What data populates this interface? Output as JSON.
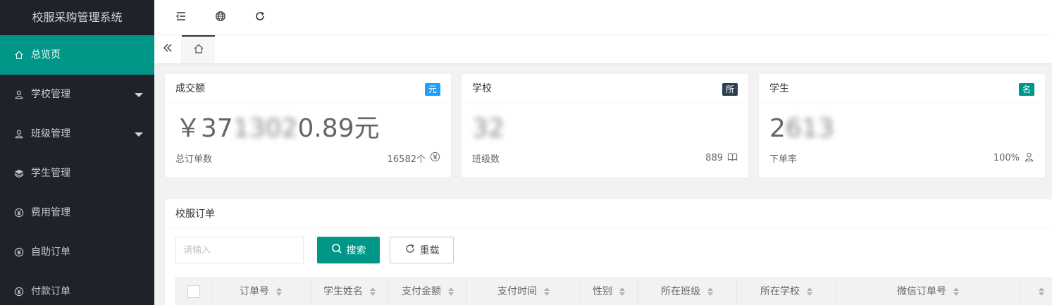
{
  "app": {
    "title": "校服采购管理系统"
  },
  "sidebar": {
    "items": [
      {
        "label": "总览页",
        "icon": "home-icon",
        "active": true
      },
      {
        "label": "学校管理",
        "icon": "user-icon",
        "has_children": true
      },
      {
        "label": "班级管理",
        "icon": "user-icon",
        "has_children": true
      },
      {
        "label": "学生管理",
        "icon": "layers-icon"
      },
      {
        "label": "费用管理",
        "icon": "yen-icon"
      },
      {
        "label": "自助订单",
        "icon": "yen-icon"
      },
      {
        "label": "付款订单",
        "icon": "yen-icon"
      }
    ]
  },
  "header": {
    "buttons": [
      "menu-fold-icon",
      "globe-icon",
      "refresh-icon"
    ]
  },
  "tabs": {
    "prev_icon": "double-left-icon",
    "home_icon": "home-icon"
  },
  "cards": [
    {
      "title": "成交额",
      "badge": "元",
      "badge_color": "#1e9fff",
      "value_prefix": "￥37",
      "value_blurred": "1302",
      "value_suffix": "0.89元",
      "foot_label": "总订单数",
      "foot_value": "16582个",
      "foot_icon": "yen-circle-icon"
    },
    {
      "title": "学校",
      "badge": "所",
      "badge_color": "#2f4056",
      "value_prefix": "",
      "value_blurred": "32",
      "value_suffix": "",
      "foot_label": "班级数",
      "foot_value": "889",
      "foot_icon": "book-icon"
    },
    {
      "title": "学生",
      "badge": "名",
      "badge_color": "#009688",
      "value_prefix": "2",
      "value_blurred": "613",
      "value_suffix": "",
      "foot_label": "下单率",
      "foot_value": "100%",
      "foot_icon": "user-icon"
    }
  ],
  "orders": {
    "title": "校服订单",
    "search_placeholder": "请输入",
    "search_label": "搜索",
    "reset_label": "重载",
    "columns": [
      "订单号",
      "学生姓名",
      "支付金额",
      "支付时间",
      "性别",
      "所在班级",
      "所在学校",
      "微信订单号"
    ]
  },
  "colors": {
    "accent": "#009688",
    "sidebar_bg": "#20222a"
  }
}
